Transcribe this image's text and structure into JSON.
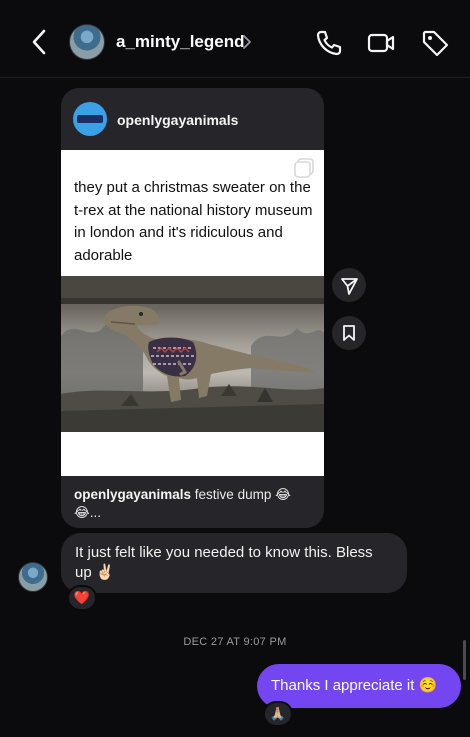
{
  "header": {
    "username": "a_minty_legend",
    "icons": [
      "back-icon",
      "chevron-right-icon",
      "phone-icon",
      "video-icon",
      "tag-icon"
    ]
  },
  "post": {
    "account": "openlygayanimals",
    "text": "they put a christmas sweater on the t-rex at the national history museum in london and it's ridiculous and adorable",
    "caption_user": "openlygayanimals",
    "caption_text": " festive dump 😂😂...",
    "side_actions": [
      "send-icon",
      "save-icon"
    ]
  },
  "messages": {
    "incoming_text": "It just felt like you needed to know this. Bless up ✌🏻",
    "incoming_reaction": "❤️",
    "timestamp": "DEC 27 AT 9:07 PM",
    "outgoing_text": "Thanks I appreciate it ☺️",
    "outgoing_reaction": "🙏🏼"
  },
  "colors": {
    "background": "#0b0b0d",
    "bubble_in": "#26262a",
    "bubble_out": "#7346f2",
    "post_avatar": "#3aa1e6"
  }
}
